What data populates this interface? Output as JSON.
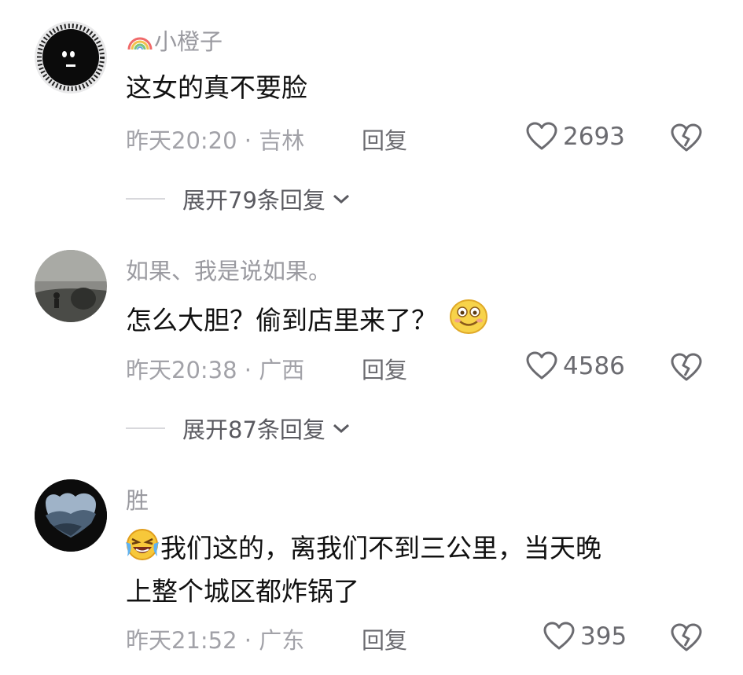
{
  "comments": [
    {
      "username": "小橙子",
      "username_prefix_icon": "rainbow-icon",
      "text": "这女的真不要脸",
      "time": "昨天20:20",
      "location": "吉林",
      "reply_label": "回复",
      "likes": "2693",
      "expand_label": "展开79条回复"
    },
    {
      "username": "如果、我是说如果。",
      "text": "怎么大胆？偷到店里来了？",
      "emoji": "smiling-face-emoji",
      "time": "昨天20:38",
      "location": "广西",
      "reply_label": "回复",
      "likes": "4586",
      "expand_label": "展开87条回复"
    },
    {
      "username": "胜",
      "emoji": "laughing-crying-emoji",
      "text_line1": "我们这的，离我们不到三公里，当天晚",
      "text_line2": "上整个城区都炸锅了",
      "time": "昨天21:52",
      "location": "广东",
      "reply_label": "回复",
      "likes": "395"
    }
  ],
  "meta_separator": " · "
}
